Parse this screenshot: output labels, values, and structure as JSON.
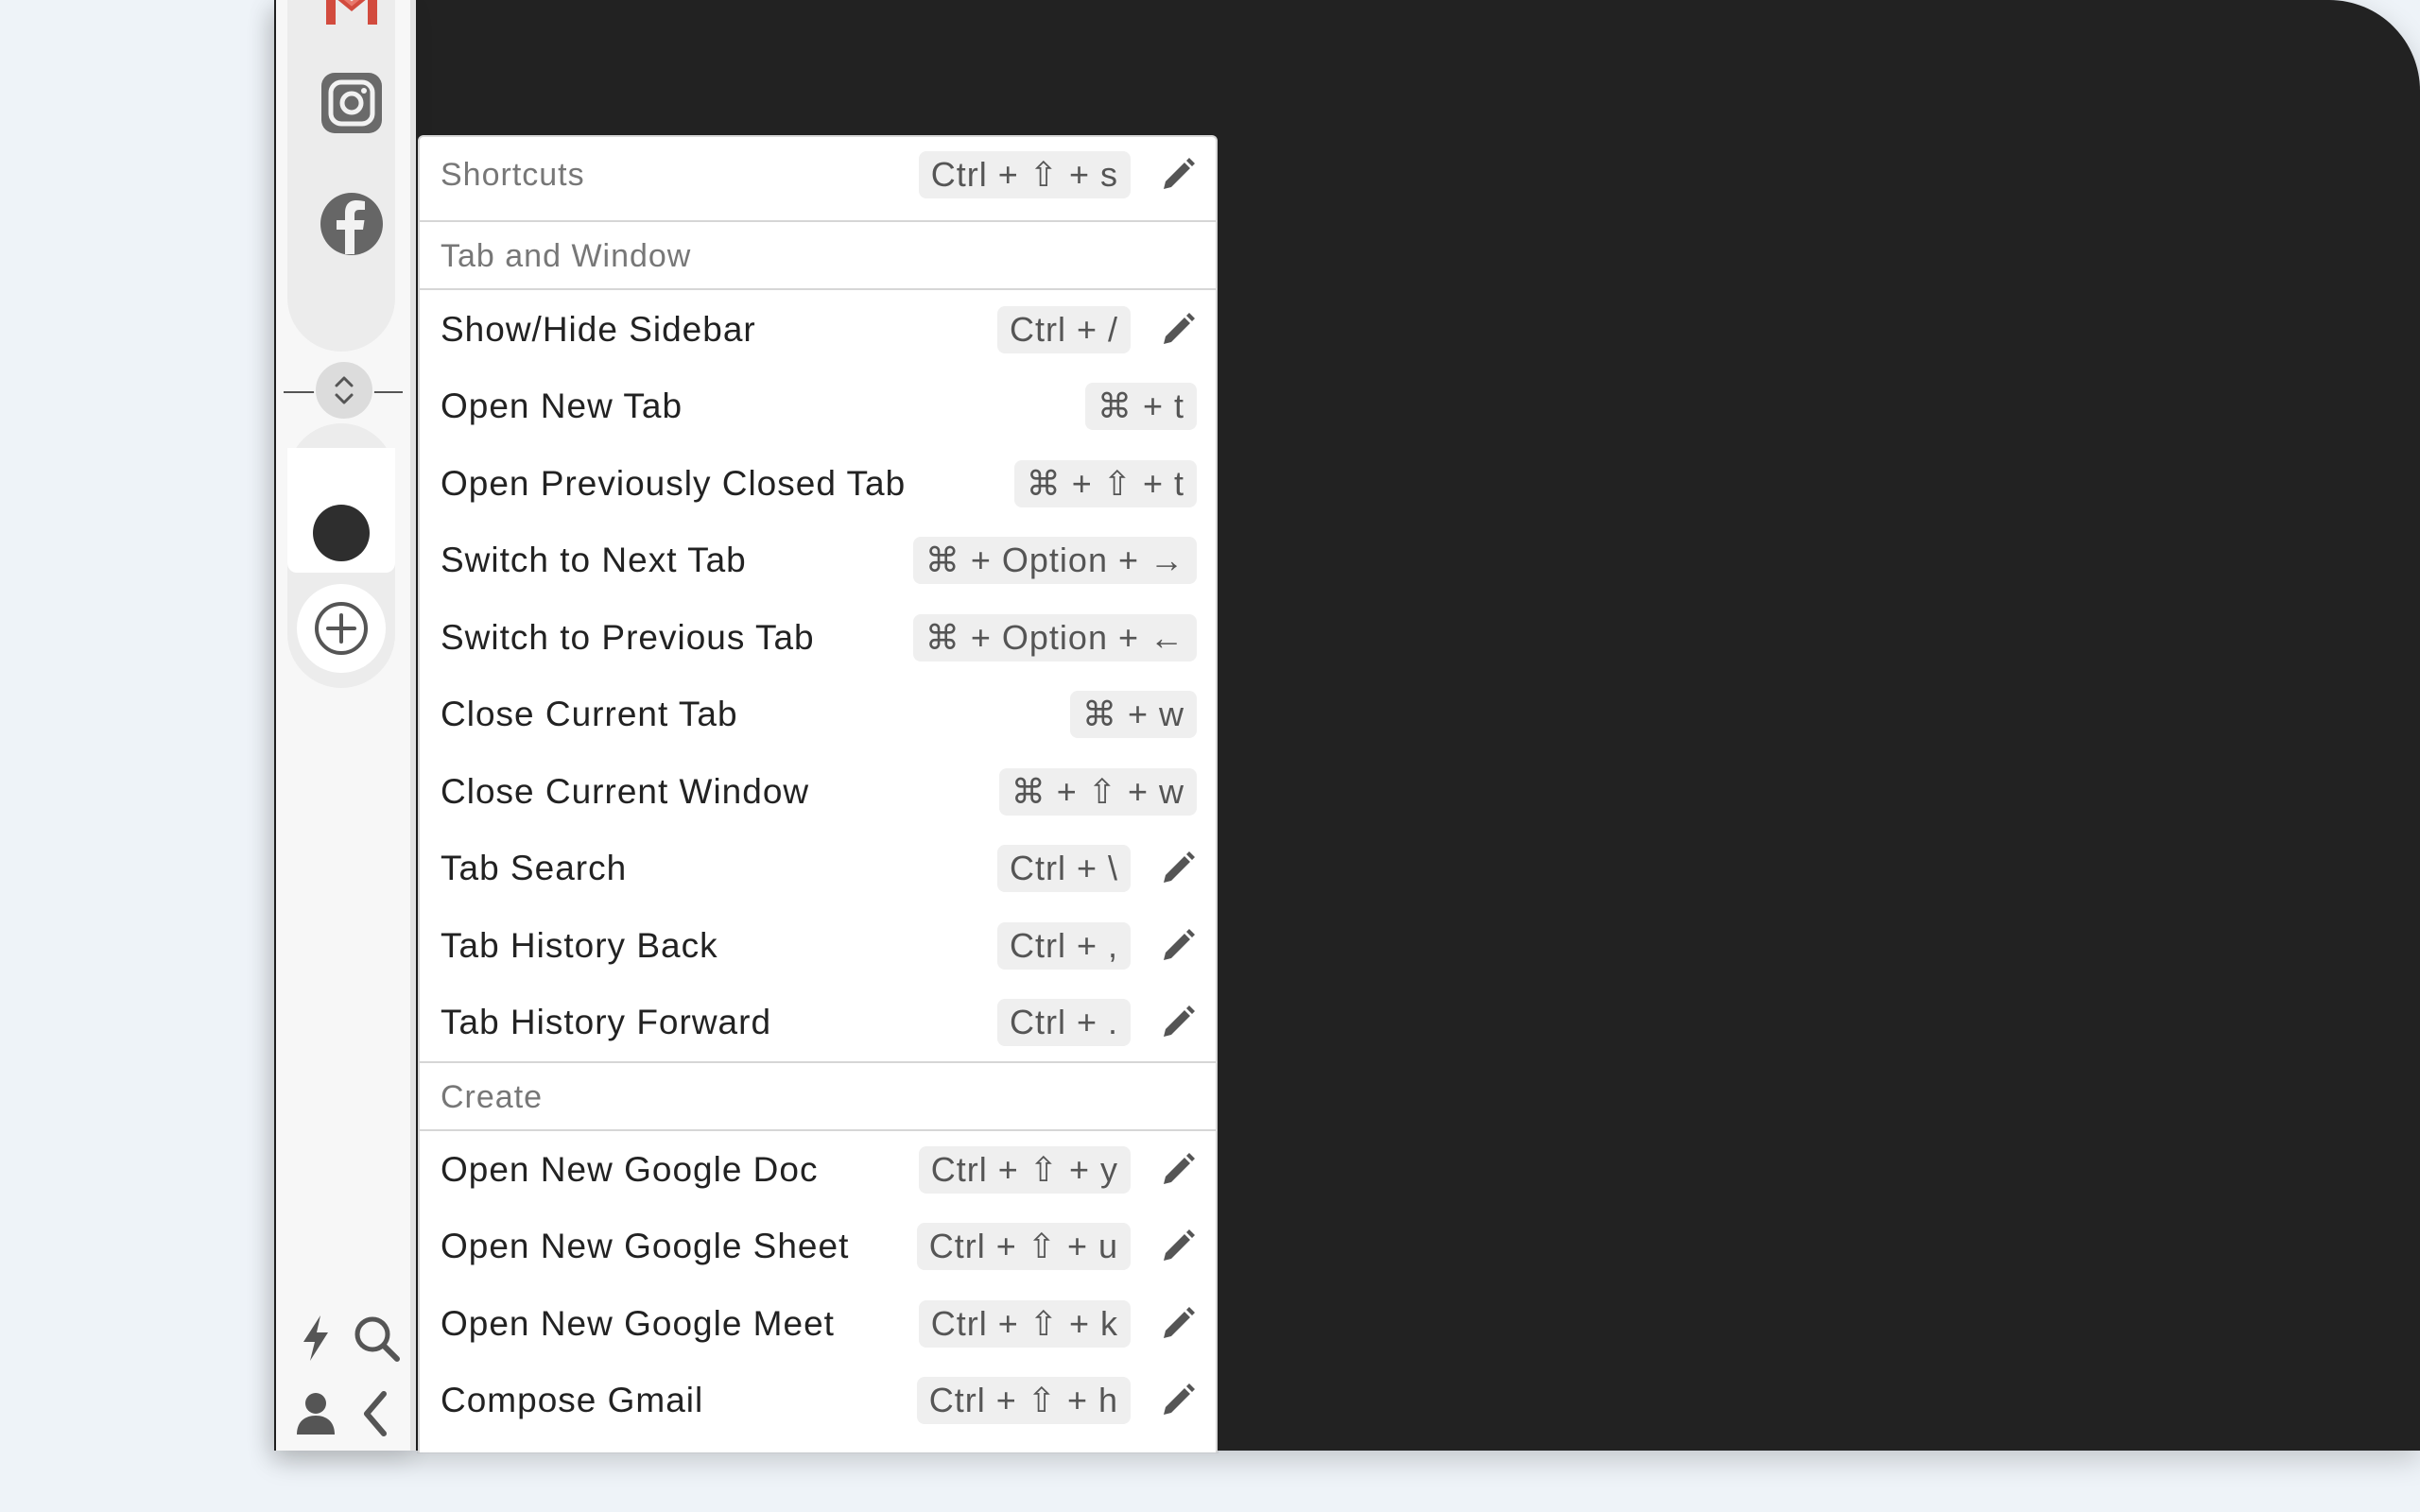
{
  "sidebar": {
    "apps": [
      {
        "name": "gmail",
        "icon": "gmail-icon",
        "color": "#d24b3e"
      },
      {
        "name": "instagram",
        "icon": "instagram-icon",
        "color": "#5a5a5a"
      },
      {
        "name": "facebook",
        "icon": "facebook-icon",
        "color": "#5a5a5a"
      }
    ],
    "bottom_icons": [
      "lightning-icon",
      "search-icon",
      "user-icon",
      "chevron-left-icon"
    ]
  },
  "panel": {
    "header": {
      "label": "Shortcuts",
      "keys": "Ctrl + ⇧ + s"
    },
    "sections": [
      {
        "title": "Tab and Window",
        "items": [
          {
            "label": "Show/Hide Sidebar",
            "keys": "Ctrl + /",
            "editable": true
          },
          {
            "label": "Open New Tab",
            "keys": "⌘ + t",
            "editable": false
          },
          {
            "label": "Open Previously Closed Tab",
            "keys": "⌘ + ⇧ + t",
            "editable": false
          },
          {
            "label": "Switch to Next Tab",
            "keys": "⌘ + Option + →",
            "editable": false
          },
          {
            "label": "Switch to Previous Tab",
            "keys": "⌘ + Option + ←",
            "editable": false
          },
          {
            "label": "Close Current Tab",
            "keys": "⌘ + w",
            "editable": false
          },
          {
            "label": "Close Current Window",
            "keys": "⌘ + ⇧ + w",
            "editable": false
          },
          {
            "label": "Tab Search",
            "keys": "Ctrl + \\",
            "editable": true
          },
          {
            "label": "Tab History Back",
            "keys": "Ctrl + ,",
            "editable": true
          },
          {
            "label": "Tab History Forward",
            "keys": "Ctrl + .",
            "editable": true
          }
        ]
      },
      {
        "title": "Create",
        "items": [
          {
            "label": "Open New Google Doc",
            "keys": "Ctrl + ⇧ + y",
            "editable": true
          },
          {
            "label": "Open New Google Sheet",
            "keys": "Ctrl + ⇧ + u",
            "editable": true
          },
          {
            "label": "Open New Google Meet",
            "keys": "Ctrl + ⇧ + k",
            "editable": true
          },
          {
            "label": "Compose Gmail",
            "keys": "Ctrl + ⇧ + h",
            "editable": true
          }
        ]
      }
    ]
  }
}
